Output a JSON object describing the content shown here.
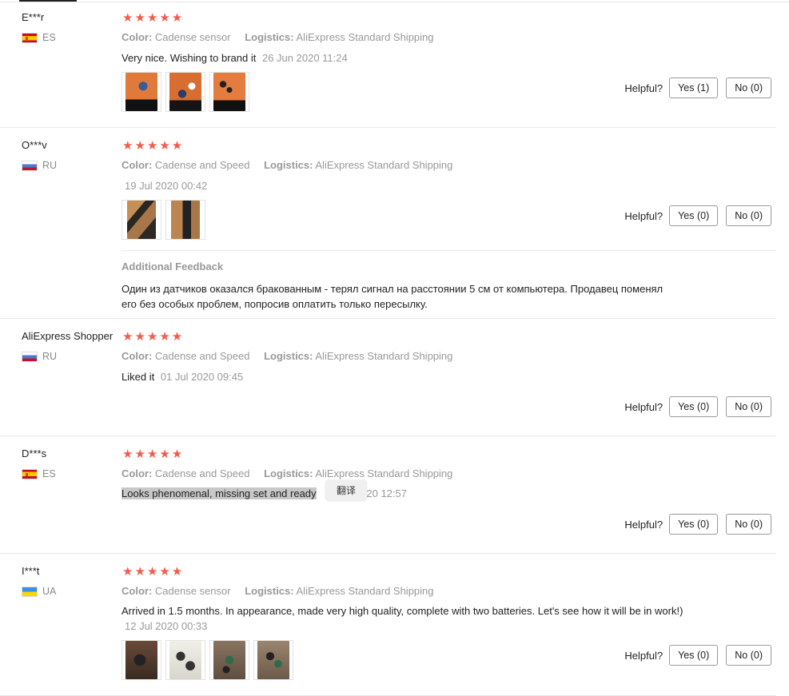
{
  "labels": {
    "color": "Color:",
    "logistics": "Logistics:",
    "helpful": "Helpful?",
    "additional_feedback": "Additional Feedback",
    "translate_popup": "翻译"
  },
  "reviews": [
    {
      "user": "E***r",
      "country": "ES",
      "stars": "★★★★★",
      "color": "Cadense sensor",
      "logistics": "AliExpress Standard Shipping",
      "text": "Very nice. Wishing to brand it",
      "date": "26 Jun 2020 11:24",
      "yes": "Yes (1)",
      "no": "No (0)"
    },
    {
      "user": "O***v",
      "country": "RU",
      "stars": "★★★★★",
      "color": "Cadense and Speed",
      "logistics": "AliExpress Standard Shipping",
      "text": "",
      "date": "19 Jul 2020 00:42",
      "yes": "Yes (0)",
      "no": "No (0)",
      "additional": "Один из датчиков оказался бракованным - терял сигнал на расстоянии 5 см от компьютера. Продавец поменял его без особых проблем, попросив оплатить только пересылку."
    },
    {
      "user": "AliExpress Shopper",
      "country": "RU",
      "stars": "★★★★★",
      "color": "Cadense and Speed",
      "logistics": "AliExpress Standard Shipping",
      "text": "Liked it",
      "date": "01 Jul 2020 09:45",
      "yes": "Yes (0)",
      "no": "No (0)"
    },
    {
      "user": "D***s",
      "country": "ES",
      "stars": "★★★★★",
      "color": "Cadense and Speed",
      "logistics": "AliExpress Standard Shipping",
      "text": "Looks phenomenal, missing set and ready",
      "date": "020 12:57",
      "yes": "Yes (0)",
      "no": "No (0)"
    },
    {
      "user": "I***t",
      "country": "UA",
      "stars": "★★★★★",
      "color": "Cadense sensor",
      "logistics": "AliExpress Standard Shipping",
      "text": "Arrived in 1.5 months. In appearance, made very high quality, complete with two batteries. Let's see how it will be in work!)",
      "date": "12 Jul 2020 00:33",
      "yes": "Yes (0)",
      "no": "No (0)"
    }
  ]
}
